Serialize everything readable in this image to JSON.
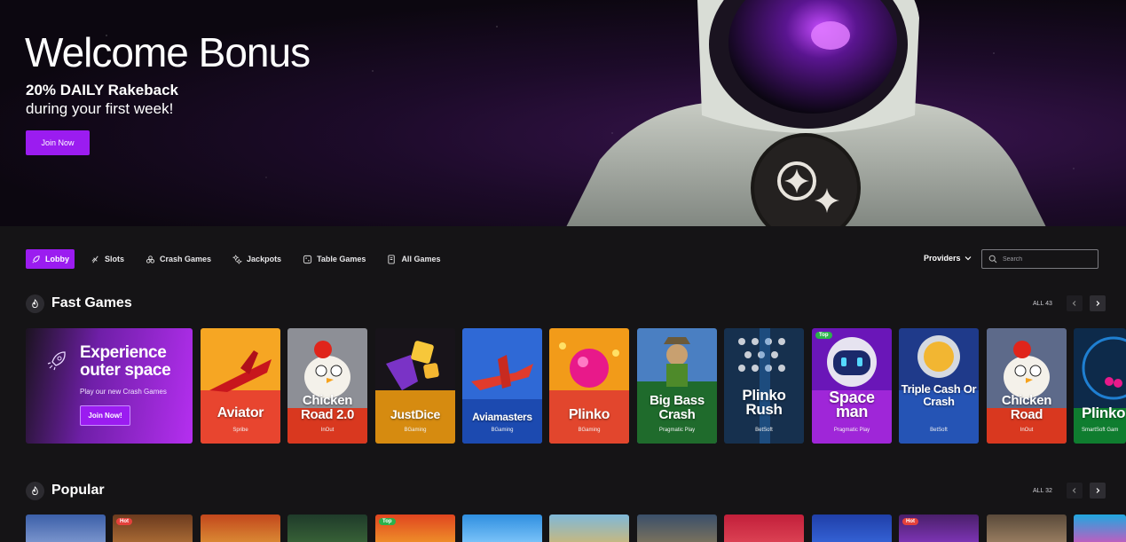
{
  "hero": {
    "title": "Welcome Bonus",
    "subtitle_bold": "20% DAILY Rakeback",
    "subtitle": "during your first week!",
    "cta": "Join Now"
  },
  "nav": {
    "tabs": [
      {
        "label": "Lobby",
        "icon": "rocket-icon",
        "active": true
      },
      {
        "label": "Slots",
        "icon": "slot-icon"
      },
      {
        "label": "Crash Games",
        "icon": "crash-icon"
      },
      {
        "label": "Jackpots",
        "icon": "jackpot-icon"
      },
      {
        "label": "Table Games",
        "icon": "dice-icon"
      },
      {
        "label": "All Games",
        "icon": "cards-icon"
      }
    ],
    "providers_label": "Providers",
    "search_placeholder": "Search"
  },
  "fast_games": {
    "title": "Fast Games",
    "all_label": "ALL 43",
    "promo": {
      "title": "Experience outer space",
      "text": "Play our new Crash Games",
      "cta": "Join Now!"
    },
    "games": [
      {
        "name": "Aviator",
        "provider": "Spribe"
      },
      {
        "name": "Chicken Road 2.0",
        "provider": "InOut"
      },
      {
        "name": "JustDice",
        "provider": "BGaming"
      },
      {
        "name": "Aviamasters",
        "provider": "BGaming"
      },
      {
        "name": "Plinko",
        "provider": "BGaming"
      },
      {
        "name": "Big Bass Crash",
        "provider": "Pragmatic Play"
      },
      {
        "name": "Plinko Rush",
        "provider": "BetSoft"
      },
      {
        "name": "Space man",
        "provider": "Pragmatic Play",
        "badge": "Top"
      },
      {
        "name": "Triple Cash Or Crash",
        "provider": "BetSoft"
      },
      {
        "name": "Chicken Road",
        "provider": "InOut"
      },
      {
        "name": "Plinko",
        "provider": "SmartSoft Gam"
      }
    ]
  },
  "popular": {
    "title": "Popular",
    "all_label": "ALL 32",
    "badges": [
      "Hot",
      "Top",
      "Hot"
    ]
  },
  "colors": {
    "accent": "#9b1cf0",
    "background": "#151416"
  }
}
